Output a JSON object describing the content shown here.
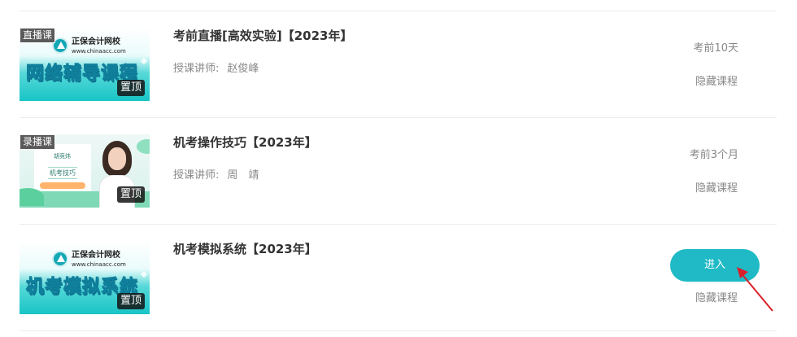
{
  "courses": [
    {
      "thumb_type": "直播课",
      "thumb_brand": "正保会计网校",
      "thumb_url": "www.chinaacc.com",
      "thumb_headline": "网络辅导课程",
      "pin": "置顶",
      "title": "考前直播[高效实验]【2023年】",
      "teacher_label": "授课讲师:",
      "teacher_name": "赵俊峰",
      "remaining": "考前10天",
      "hide": "隐藏课程"
    },
    {
      "thumb_type": "录播课",
      "thumb_teacher_line": "胡竞炜",
      "thumb_topic": "机考技巧",
      "pin": "置顶",
      "title": "机考操作技巧【2023年】",
      "teacher_label": "授课讲师:",
      "teacher_name": "周　靖",
      "remaining": "考前3个月",
      "hide": "隐藏课程"
    },
    {
      "thumb_brand": "正保会计网校",
      "thumb_url": "www.chinaacc.com",
      "thumb_headline": "机考模拟系统",
      "pin": "置顶",
      "title": "机考模拟系统【2023年】",
      "enter": "进入",
      "hide": "隐藏课程"
    }
  ],
  "colors": {
    "accent": "#1fbac5",
    "arrow": "#d9202a",
    "divider": "#ebebeb"
  }
}
